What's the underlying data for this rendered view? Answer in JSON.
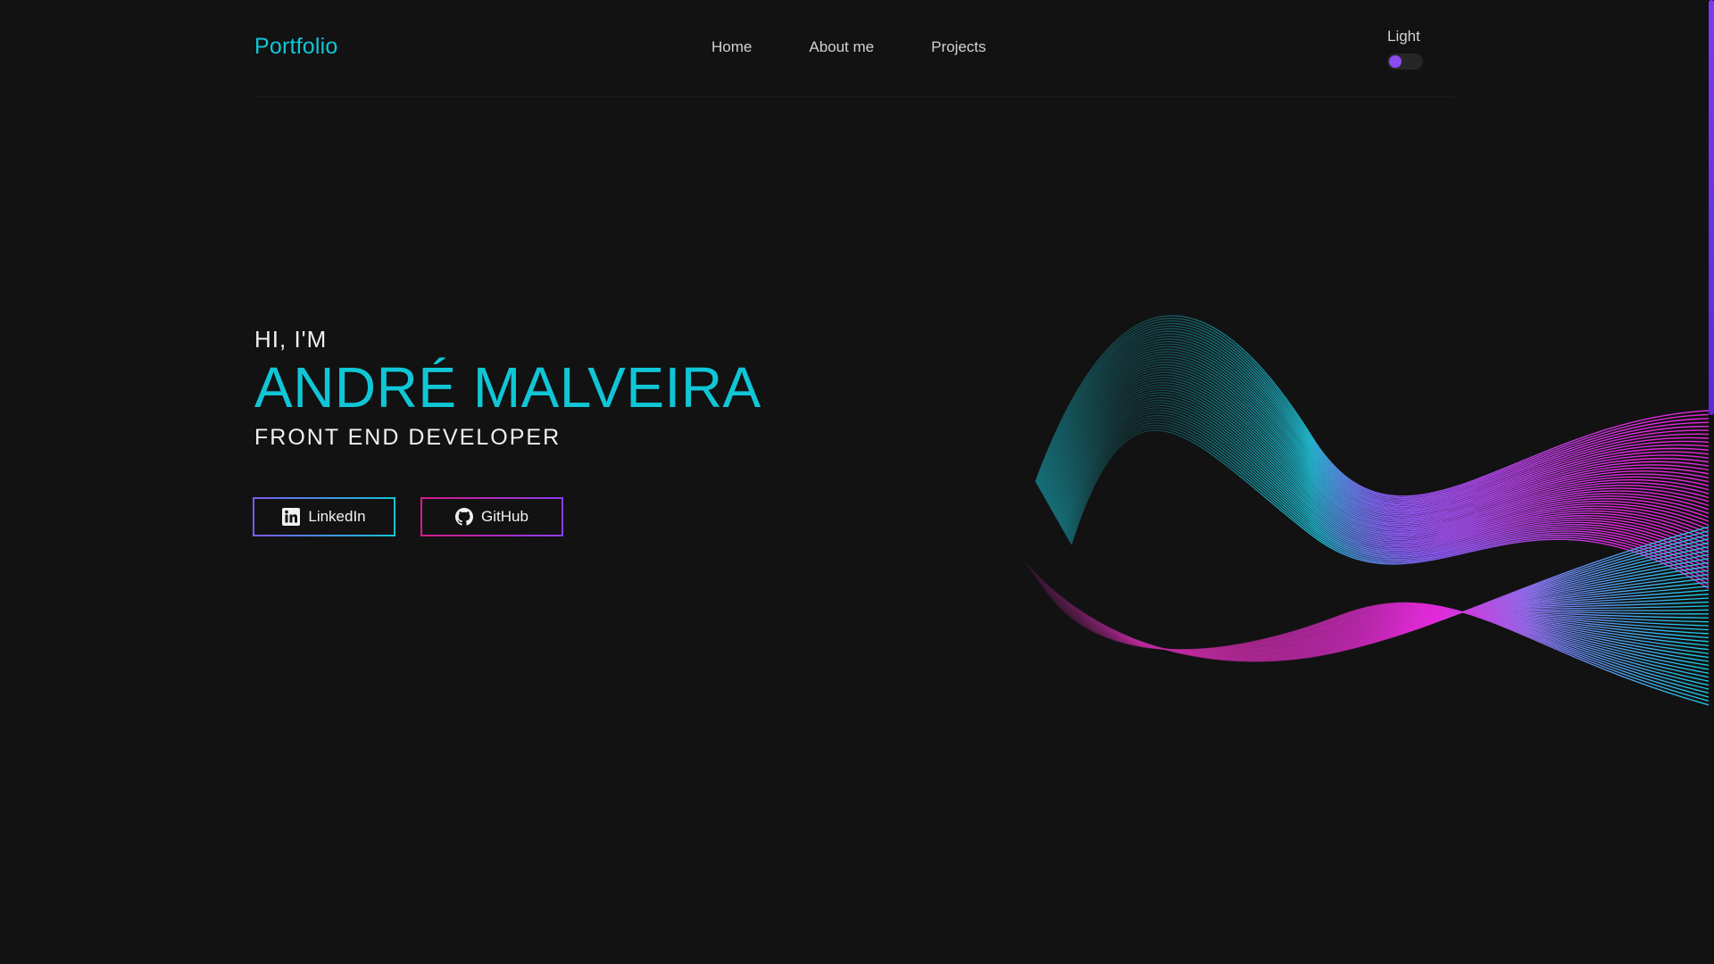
{
  "header": {
    "logo": "Portfolio",
    "nav": [
      "Home",
      "About me",
      "Projects"
    ],
    "theme_toggle_label": "Light"
  },
  "hero": {
    "greeting": "HI, I'M",
    "name": "ANDRÉ MALVEIRA",
    "role": "FRONT END DEVELOPER"
  },
  "socials": {
    "linkedin_label": "LinkedIn",
    "github_label": "GitHub"
  },
  "icons": {
    "linkedin": "linkedin-icon",
    "github": "github-icon"
  },
  "colors": {
    "background": "#121212",
    "accent": "#10c6d6",
    "toggle_knob": "#8b4bf0",
    "wave_cyan": "#19d0e6",
    "wave_magenta": "#e02ad9",
    "wave_violet": "#8a5cf6"
  }
}
